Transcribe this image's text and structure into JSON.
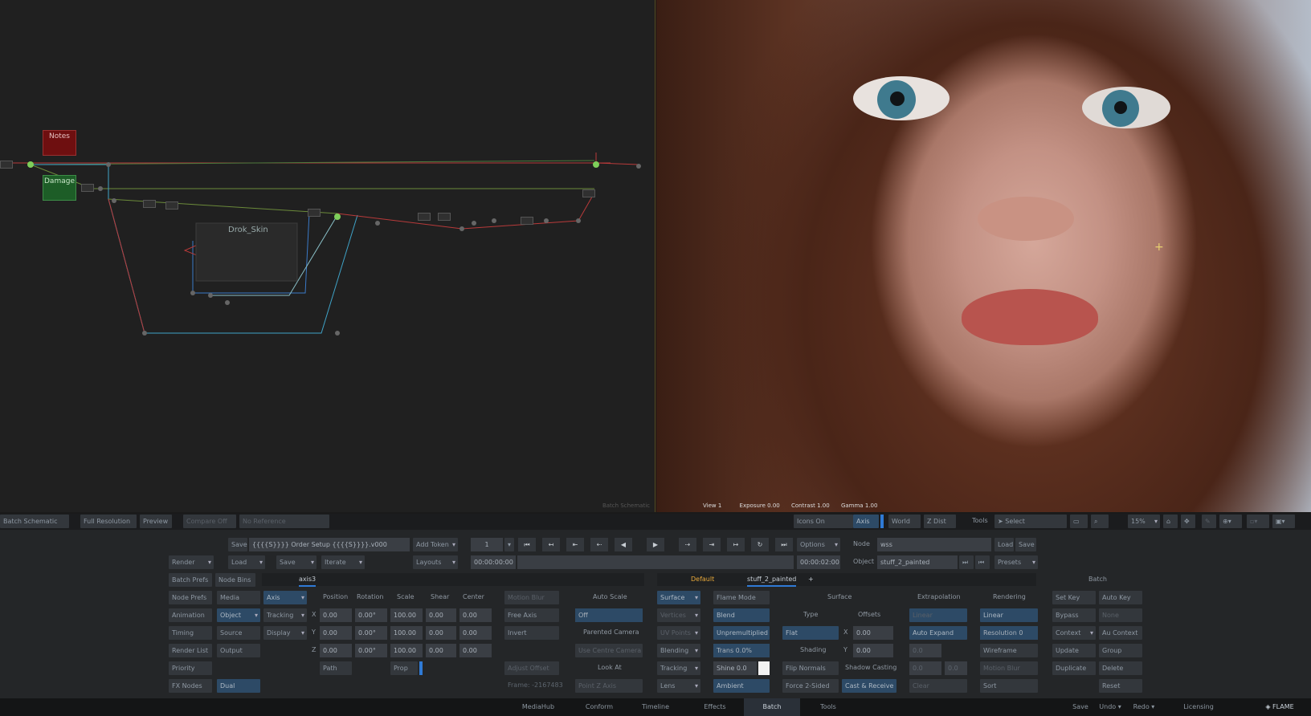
{
  "schematic": {
    "nodes": {
      "notes": "Notes",
      "damage": "Damage",
      "group": "Drok_Skin"
    },
    "footer": "Batch Schematic"
  },
  "viewer": {
    "info": {
      "view": "View 1",
      "exposure": "Exposure 0.00",
      "contrast": "Contrast 1.00",
      "gamma": "Gamma 1.00"
    }
  },
  "toolbar": {
    "schematic_mode": "Batch Schematic",
    "full_resolution": "Full Resolution",
    "preview": "Preview",
    "compare": "Compare Off",
    "no_reference": "No Reference",
    "icons_on": "Icons On",
    "axis": "Axis",
    "world": "World",
    "zdist": "Z Dist",
    "tools": "Tools",
    "select": "Select",
    "zoom": "15%"
  },
  "batch": {
    "render": "Render",
    "save_field_btn": "Save",
    "setup_name": "{{{{S}}}} Order Setup {{{{S}}}}.v000",
    "add_token": "Add Token",
    "load": "Load",
    "save": "Save",
    "iterate": "Iterate",
    "layouts": "Layouts",
    "frame": "1",
    "timecode_start": "00:00:00:00",
    "timecode_end": "00:00:02:00",
    "options": "Options",
    "node_label": "Node",
    "node_value": "wss",
    "object_label": "Object",
    "object_value": "stuff_2_painted",
    "node_load": "Load",
    "node_save": "Save",
    "presets": "Presets",
    "batch_prefs": "Batch Prefs",
    "node_bins": "Node Bins",
    "node_tab": "axis3",
    "default": "Default",
    "painted_tab": "stuff_2_painted",
    "plus": "+",
    "batch_title": "Batch"
  },
  "axis": {
    "left_buttons": [
      "Node Prefs",
      "Animation",
      "Timing",
      "Render List",
      "Priority",
      "FX Nodes"
    ],
    "col2": [
      "Media",
      "Object",
      "Source",
      "Output"
    ],
    "col3": [
      "Axis",
      "Tracking",
      "Display"
    ],
    "dual": "Dual",
    "headers": [
      "Position",
      "Rotation",
      "Scale",
      "Shear",
      "Center"
    ],
    "axes": [
      "X",
      "Y",
      "Z"
    ],
    "rows": [
      [
        "0.00",
        "0.00°",
        "100.00",
        "0.00",
        "0.00"
      ],
      [
        "0.00",
        "0.00°",
        "100.00",
        "0.00",
        "0.00"
      ],
      [
        "0.00",
        "0.00°",
        "100.00",
        "0.00",
        "0.00"
      ]
    ],
    "path": "Path",
    "prop": "Prop",
    "motion_blur": "Motion Blur",
    "free_axis": "Free Axis",
    "invert": "Invert",
    "adjust_offset": "Adjust Offset",
    "frame_readout": "Frame: -2167483",
    "auto_scale": "Auto Scale",
    "auto_scale_value": "Off",
    "parented_camera": "Parented Camera",
    "use_camera": "Use Centre Camera",
    "look_at": "Look At",
    "point_z": "Point Z Axis"
  },
  "surface": {
    "surface": "Surface",
    "vertices": "Vertices",
    "uv_points": "UV Points",
    "blending": "Blending",
    "tracking": "Tracking",
    "lens": "Lens",
    "flame_mode": "Flame Mode",
    "blend": "Blend",
    "unpremultiplied": "Unpremultiplied",
    "trans": "Trans 0.0%",
    "shine": "Shine 0.0",
    "ambient": "Ambient",
    "surface_title": "Surface",
    "type": "Type",
    "offsets": "Offsets",
    "flat": "Flat",
    "x_label": "X",
    "y_label": "Y",
    "offset_x": "0.00",
    "offset_y": "0.00",
    "shading": "Shading",
    "flip_normals": "Flip Normals",
    "shadow_casting": "Shadow Casting",
    "force_2sided": "Force 2-Sided",
    "cast_receive": "Cast & Receive",
    "extrapolation": "Extrapolation",
    "linear_e": "Linear",
    "auto_expand": "Auto Expand",
    "val1": "0.0",
    "val2": "0.0",
    "val3": "0.0",
    "clear": "Clear",
    "rendering": "Rendering",
    "linear_r": "Linear",
    "resolution": "Resolution 0",
    "wireframe": "Wireframe",
    "motion_blur": "Motion Blur",
    "sort": "Sort",
    "set_key": "Set Key",
    "auto_key": "Auto Key",
    "bypass": "Bypass",
    "none": "None",
    "context": "Context",
    "au_context": "Au Context",
    "update": "Update",
    "group": "Group",
    "duplicate": "Duplicate",
    "delete": "Delete",
    "reset": "Reset"
  },
  "statusbar": {
    "tabs": [
      "MediaHub",
      "Conform",
      "Timeline",
      "Effects",
      "Batch",
      "Tools"
    ],
    "save": "Save",
    "undo": "Undo",
    "redo": "Redo",
    "licensing": "Licensing",
    "brand": "FLAME"
  },
  "colors": {
    "accent": "#2f7ad6",
    "node_red": "#6e0f10",
    "node_green": "#1d5d27"
  }
}
